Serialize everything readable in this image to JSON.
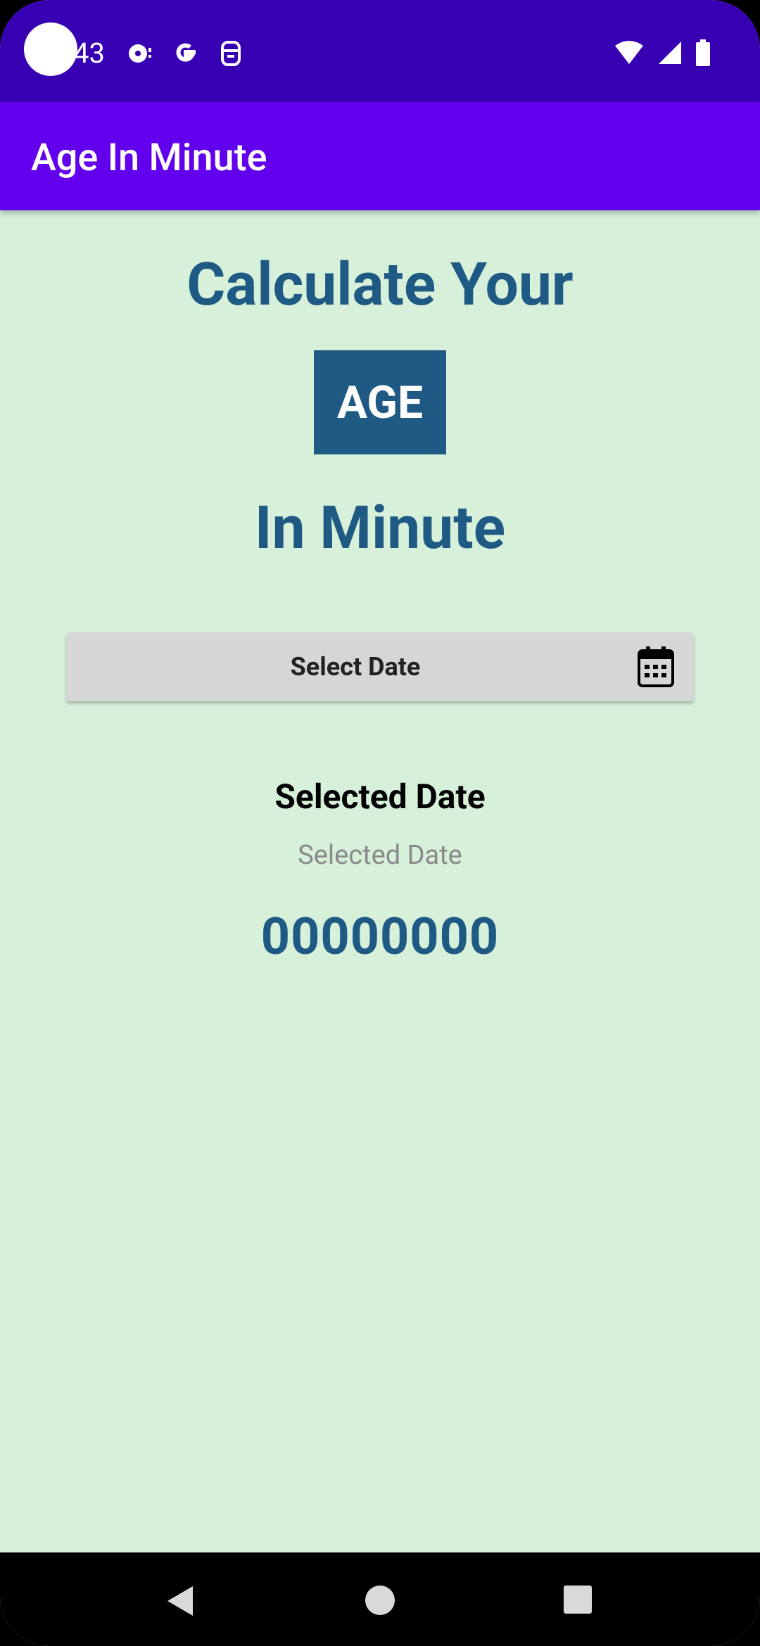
{
  "status_bar": {
    "time": "43",
    "icons_left": [
      "media-icon",
      "google-icon",
      "screenshot-icon"
    ],
    "icons_right": [
      "wifi-icon",
      "signal-icon",
      "battery-icon"
    ]
  },
  "app_bar": {
    "title": "Age In Minute"
  },
  "main": {
    "heading_top": "Calculate Your",
    "badge": "AGE",
    "heading_bottom": "In Minute",
    "select_button_label": "Select Date",
    "selected_date_title": "Selected Date",
    "selected_date_value": "Selected Date",
    "minutes_value": "00000000"
  },
  "colors": {
    "status_bar": "#3700b3",
    "app_bar": "#6200ee",
    "background": "#d6f0da",
    "accent": "#1f5a84",
    "button": "#d6d6d6"
  },
  "nav_bar": {
    "buttons": [
      "back-icon",
      "home-icon",
      "recents-icon"
    ]
  }
}
